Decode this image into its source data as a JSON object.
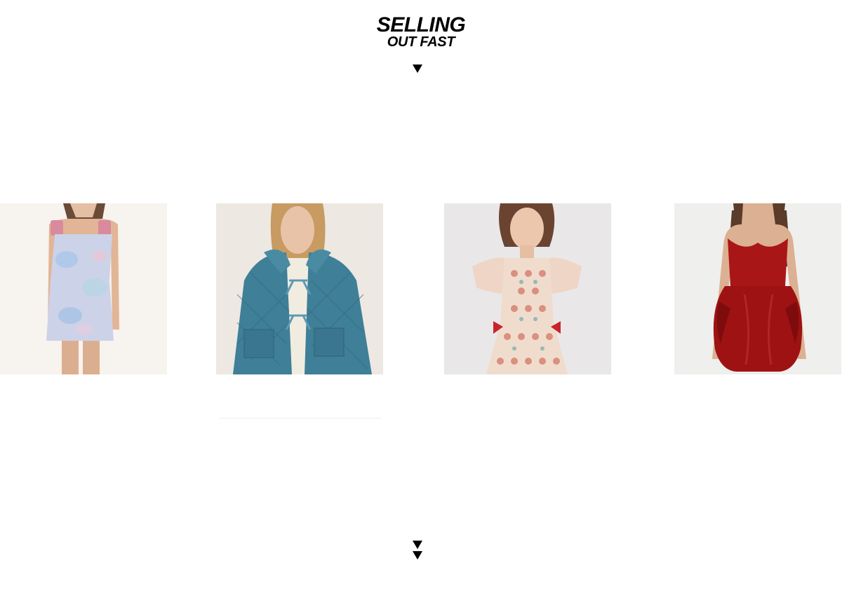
{
  "heading": {
    "line1": "SELLING",
    "line2": "OUT FAST"
  },
  "products": [
    {
      "name": "pastel-jacquard-mini-dress"
    },
    {
      "name": "quilted-denim-tie-jacket"
    },
    {
      "name": "floral-ruffle-sleeve-dress"
    },
    {
      "name": "red-satin-strapless-mini-dress"
    }
  ],
  "colors": {
    "text": "#000000",
    "background": "#ffffff",
    "dress1": "#c9cde6",
    "jacket": "#3e7e97",
    "dress3": "#e9c9b8",
    "dress4": "#a51515"
  }
}
